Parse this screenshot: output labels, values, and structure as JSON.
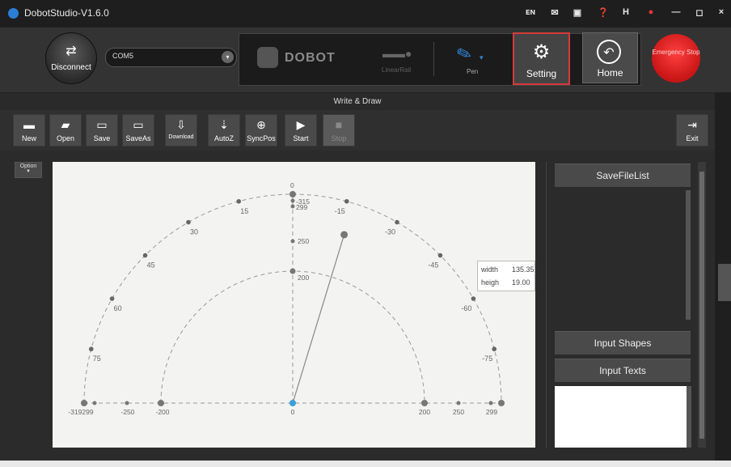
{
  "titlebar": {
    "title": "DobotStudio-V1.6.0",
    "icons": [
      "language-icon",
      "mail-icon",
      "save-icon",
      "help-icon",
      "H",
      "skin-icon",
      "minimize-icon",
      "maximize-icon",
      "close-icon"
    ],
    "icon_glyphs": [
      "ᴇɴ",
      "✉",
      "▣",
      "❓",
      "H",
      "🎨",
      "—",
      "◻",
      "×"
    ]
  },
  "topbar": {
    "disconnect_label": "Disconnect",
    "port_value": "COM5",
    "device_name": "DOBOT",
    "linear_rail_label": "LinearRail",
    "end_effector_label": "Pen",
    "setting_label": "Setting",
    "home_label": "Home",
    "estop_label": "Emergency Stop"
  },
  "section_title": "Write & Draw",
  "tools": [
    {
      "label": "New",
      "icon": "▬"
    },
    {
      "label": "Open",
      "icon": "▰"
    },
    {
      "label": "Save",
      "icon": "▭"
    },
    {
      "label": "SaveAs",
      "icon": "▭"
    },
    {
      "label": "Download",
      "icon": "⇩"
    },
    {
      "label": "AutoZ",
      "icon": "⇣"
    },
    {
      "label": "SyncPos",
      "icon": "⊕"
    },
    {
      "label": "Start",
      "icon": "▶"
    },
    {
      "label": "Stop",
      "icon": "■"
    }
  ],
  "exit_label": "Exit",
  "option_label": "Option",
  "canvas": {
    "outer_arc_labels": [
      "15",
      "30",
      "45",
      "60",
      "75",
      "-15",
      "-30",
      "-45",
      "-60",
      "-75"
    ],
    "center_top_labels": [
      "0",
      "-315",
      "299",
      "250",
      "200"
    ],
    "bottom_labels": [
      "-319299",
      "-250",
      "-200",
      "0",
      "200",
      "250",
      "299"
    ],
    "arm": {
      "angle_deg": 17,
      "radius": 259
    }
  },
  "info": {
    "width_label": "width",
    "width_value": "135.35",
    "height_label": "heigh",
    "height_value": "19.00"
  },
  "right_panel": {
    "savefilelist_label": "SaveFileList",
    "input_shapes_label": "Input Shapes",
    "input_texts_label": "Input Texts"
  },
  "colors": {
    "setting_border": "#d63a3a",
    "estop": "#e02020",
    "pen_blue": "#2f86d6",
    "origin_dot": "#3aa0d8"
  }
}
